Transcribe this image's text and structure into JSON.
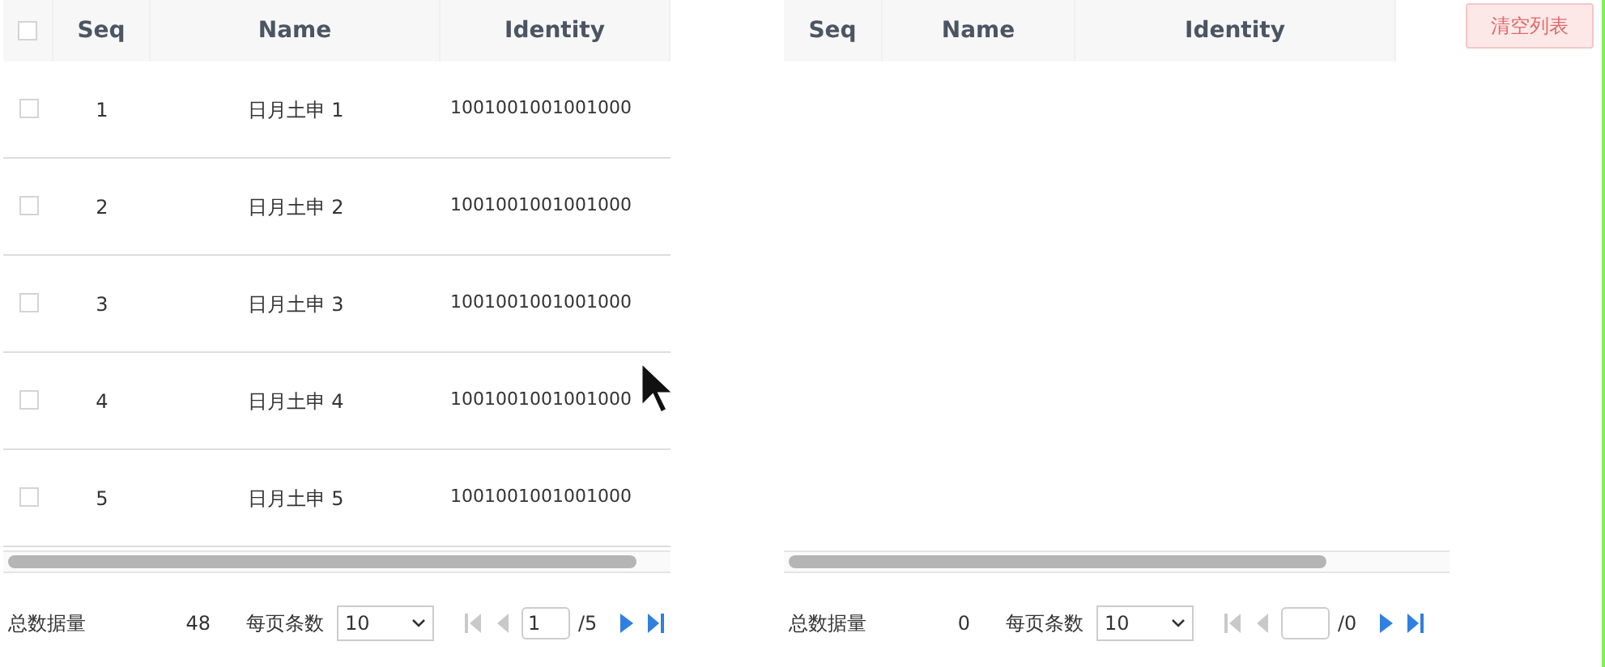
{
  "left_table": {
    "select_all": {
      "checked": false
    },
    "columns": [
      "Seq",
      "Name",
      "Identity"
    ],
    "rows": [
      {
        "checked": false,
        "seq": "1",
        "name": "日月土申 1",
        "identity": "1001001001001000"
      },
      {
        "checked": false,
        "seq": "2",
        "name": "日月土申 2",
        "identity": "1001001001001000"
      },
      {
        "checked": false,
        "seq": "3",
        "name": "日月土申 3",
        "identity": "1001001001001000"
      },
      {
        "checked": false,
        "seq": "4",
        "name": "日月土申 4",
        "identity": "1001001001001000"
      },
      {
        "checked": false,
        "seq": "5",
        "name": "日月土申 5",
        "identity": "1001001001001000"
      }
    ],
    "pager": {
      "total_label": "总数据量",
      "total": "48",
      "page_size_label": "每页条数",
      "page_size": "10",
      "page": "1",
      "pages": "/5"
    }
  },
  "right_table": {
    "columns": [
      "Seq",
      "Name",
      "Identity"
    ],
    "pager": {
      "total_label": "总数据量",
      "total": "0",
      "page_size_label": "每页条数",
      "page_size": "10",
      "pages": "/0"
    }
  },
  "clear_button": "清空列表"
}
